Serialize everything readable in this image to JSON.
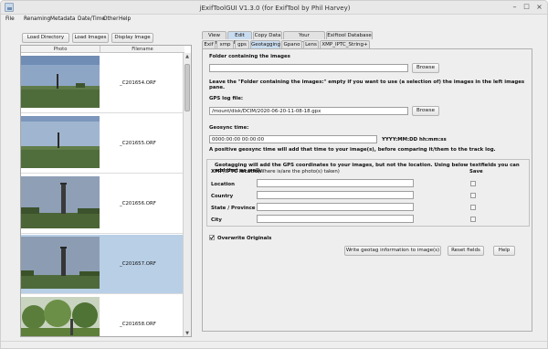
{
  "window": {
    "title": "jExifToolGUI V1.3.0   (for ExifTool by Phil Harvey)"
  },
  "menu": [
    "File",
    "Renaming",
    "Metadata",
    "Date/Time",
    "Other",
    "Help"
  ],
  "left_buttons": {
    "load_directory": "Load Directory",
    "load_images": "Load Images",
    "display_image": "Display Image"
  },
  "table": {
    "headers": [
      "Photo",
      "Filename"
    ],
    "rows": [
      {
        "filename": "_C201654.ORF",
        "selected": false
      },
      {
        "filename": "_C201655.ORF",
        "selected": false
      },
      {
        "filename": "_C201656.ORF",
        "selected": false
      },
      {
        "filename": "_C201657.ORF",
        "selected": true
      },
      {
        "filename": "_C201658.ORF",
        "selected": false
      }
    ]
  },
  "main_tabs": [
    "View Data",
    "Edit Data",
    "Copy Data",
    "Your Commands",
    "Exiftool Database"
  ],
  "main_tab_active": "Edit Data",
  "sub_tabs": [
    "Exif",
    "xmp",
    "gps",
    "Geotagging",
    "Gpano",
    "Lens",
    "XMP_IPTC_String+"
  ],
  "sub_tab_active": "Geotagging",
  "geotag": {
    "folder_label": "Folder containing the images",
    "folder_value": "",
    "browse1": "Browse",
    "folder_hint": "Leave the \"Folder containing the images:\" empty if you want to use (a selection of) the images in the left images pane.",
    "gps_log_label": "GPS log file:",
    "gps_log_value": "/mount/disk/DCIM/2020-06-20-11-08-18.gpx",
    "browse2": "Browse",
    "geosync_label": "Geosync time:",
    "geosync_value": "0000:00:00 00:00:00",
    "geosync_format": "YYYY:MM:DD hh:mm:ss",
    "geosync_hint": "A positive geosync time will add that time to your image(s), before comparing it/them to the track log.",
    "info_text": "Geotagging will add the GPS coordinates to your images, but not the location. Using below textfields you can add that as well.",
    "xmp_iptc_location": "XMP/IPTC location",
    "where_taken": "(Where is/are the photo(s) taken)",
    "save_header": "Save",
    "fields": [
      {
        "label": "Location",
        "value": ""
      },
      {
        "label": "Country",
        "value": ""
      },
      {
        "label": "State / Province",
        "value": ""
      },
      {
        "label": "City",
        "value": ""
      }
    ],
    "overwrite_label": "Overwrite Originals",
    "overwrite_checked": true,
    "write_button": "Write geotag information to image(s)",
    "reset_button": "Reset fields",
    "help_button": "Help"
  }
}
